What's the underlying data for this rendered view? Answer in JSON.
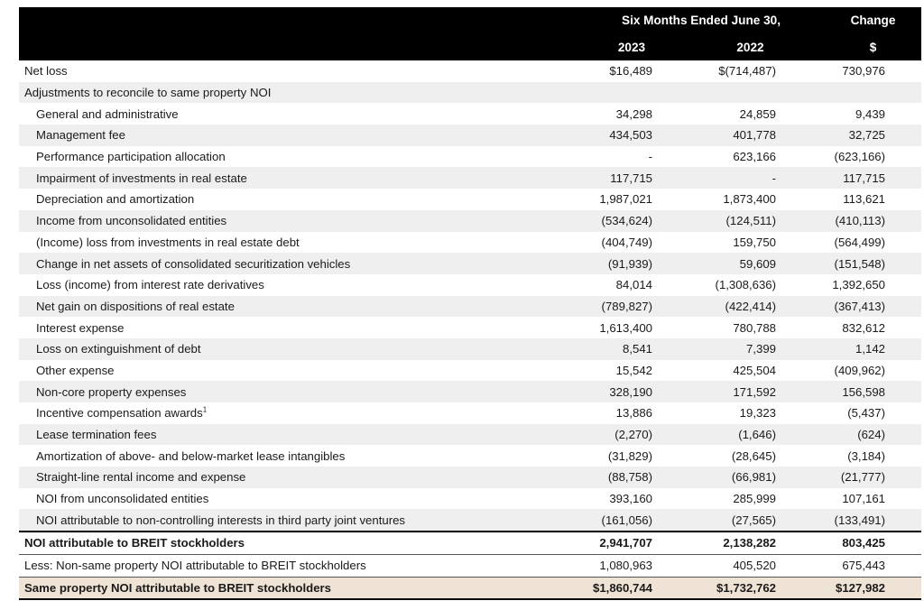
{
  "header": {
    "period_label": "Six Months Ended June 30,",
    "change_label": "Change",
    "year_2023": "2023",
    "year_2022": "2022",
    "change_unit": "$"
  },
  "rows": [
    {
      "label": "Net loss",
      "v2023": "$16,489",
      "v2022": "$(714,487)",
      "change": "730,976"
    },
    {
      "label": "Adjustments to reconcile to same property NOI",
      "v2023": "",
      "v2022": "",
      "change": ""
    },
    {
      "label": "General and administrative",
      "v2023": "34,298",
      "v2022": "24,859",
      "change": "9,439"
    },
    {
      "label": "Management fee",
      "v2023": "434,503",
      "v2022": "401,778",
      "change": "32,725"
    },
    {
      "label": "Performance participation allocation",
      "v2023": "-",
      "v2022": "623,166",
      "change": "(623,166)"
    },
    {
      "label": "Impairment of investments in real estate",
      "v2023": "117,715",
      "v2022": "-",
      "change": "117,715"
    },
    {
      "label": "Depreciation and amortization",
      "v2023": "1,987,021",
      "v2022": "1,873,400",
      "change": "113,621"
    },
    {
      "label": "Income from unconsolidated entities",
      "v2023": "(534,624)",
      "v2022": "(124,511)",
      "change": "(410,113)"
    },
    {
      "label": "(Income) loss from investments in real estate debt",
      "v2023": "(404,749)",
      "v2022": "159,750",
      "change": "(564,499)"
    },
    {
      "label": "Change in net assets of consolidated securitization vehicles",
      "v2023": "(91,939)",
      "v2022": "59,609",
      "change": "(151,548)"
    },
    {
      "label": "Loss (income) from interest rate derivatives",
      "v2023": "84,014",
      "v2022": "(1,308,636)",
      "change": "1,392,650"
    },
    {
      "label": "Net gain on dispositions of real estate",
      "v2023": "(789,827)",
      "v2022": "(422,414)",
      "change": "(367,413)"
    },
    {
      "label": "Interest expense",
      "v2023": "1,613,400",
      "v2022": "780,788",
      "change": "832,612"
    },
    {
      "label": "Loss on extinguishment of debt",
      "v2023": "8,541",
      "v2022": "7,399",
      "change": "1,142"
    },
    {
      "label": "Other expense",
      "v2023": "15,542",
      "v2022": "425,504",
      "change": "(409,962)"
    },
    {
      "label": "Non-core property expenses",
      "v2023": "328,190",
      "v2022": "171,592",
      "change": "156,598"
    },
    {
      "label": "Incentive compensation awards",
      "sup": "1",
      "v2023": "13,886",
      "v2022": "19,323",
      "change": "(5,437)"
    },
    {
      "label": "Lease termination fees",
      "v2023": "(2,270)",
      "v2022": "(1,646)",
      "change": "(624)"
    },
    {
      "label": "Amortization of above- and below-market lease intangibles",
      "v2023": "(31,829)",
      "v2022": "(28,645)",
      "change": "(3,184)"
    },
    {
      "label": "Straight-line rental income and expense",
      "v2023": "(88,758)",
      "v2022": "(66,981)",
      "change": "(21,777)"
    },
    {
      "label": "NOI from unconsolidated entities",
      "v2023": "393,160",
      "v2022": "285,999",
      "change": "107,161"
    },
    {
      "label": "NOI attributable to non-controlling interests in third party joint ventures",
      "v2023": "(161,056)",
      "v2022": "(27,565)",
      "change": "(133,491)"
    },
    {
      "label": "NOI attributable to BREIT stockholders",
      "v2023": "2,941,707",
      "v2022": "2,138,282",
      "change": "803,425"
    },
    {
      "label": "Less: Non-same property NOI attributable to BREIT stockholders",
      "v2023": "1,080,963",
      "v2022": "405,520",
      "change": "675,443"
    },
    {
      "label": "Same property NOI attributable to BREIT stockholders",
      "v2023": "$1,860,744",
      "v2022": "$1,732,762",
      "change": "$127,982"
    }
  ]
}
